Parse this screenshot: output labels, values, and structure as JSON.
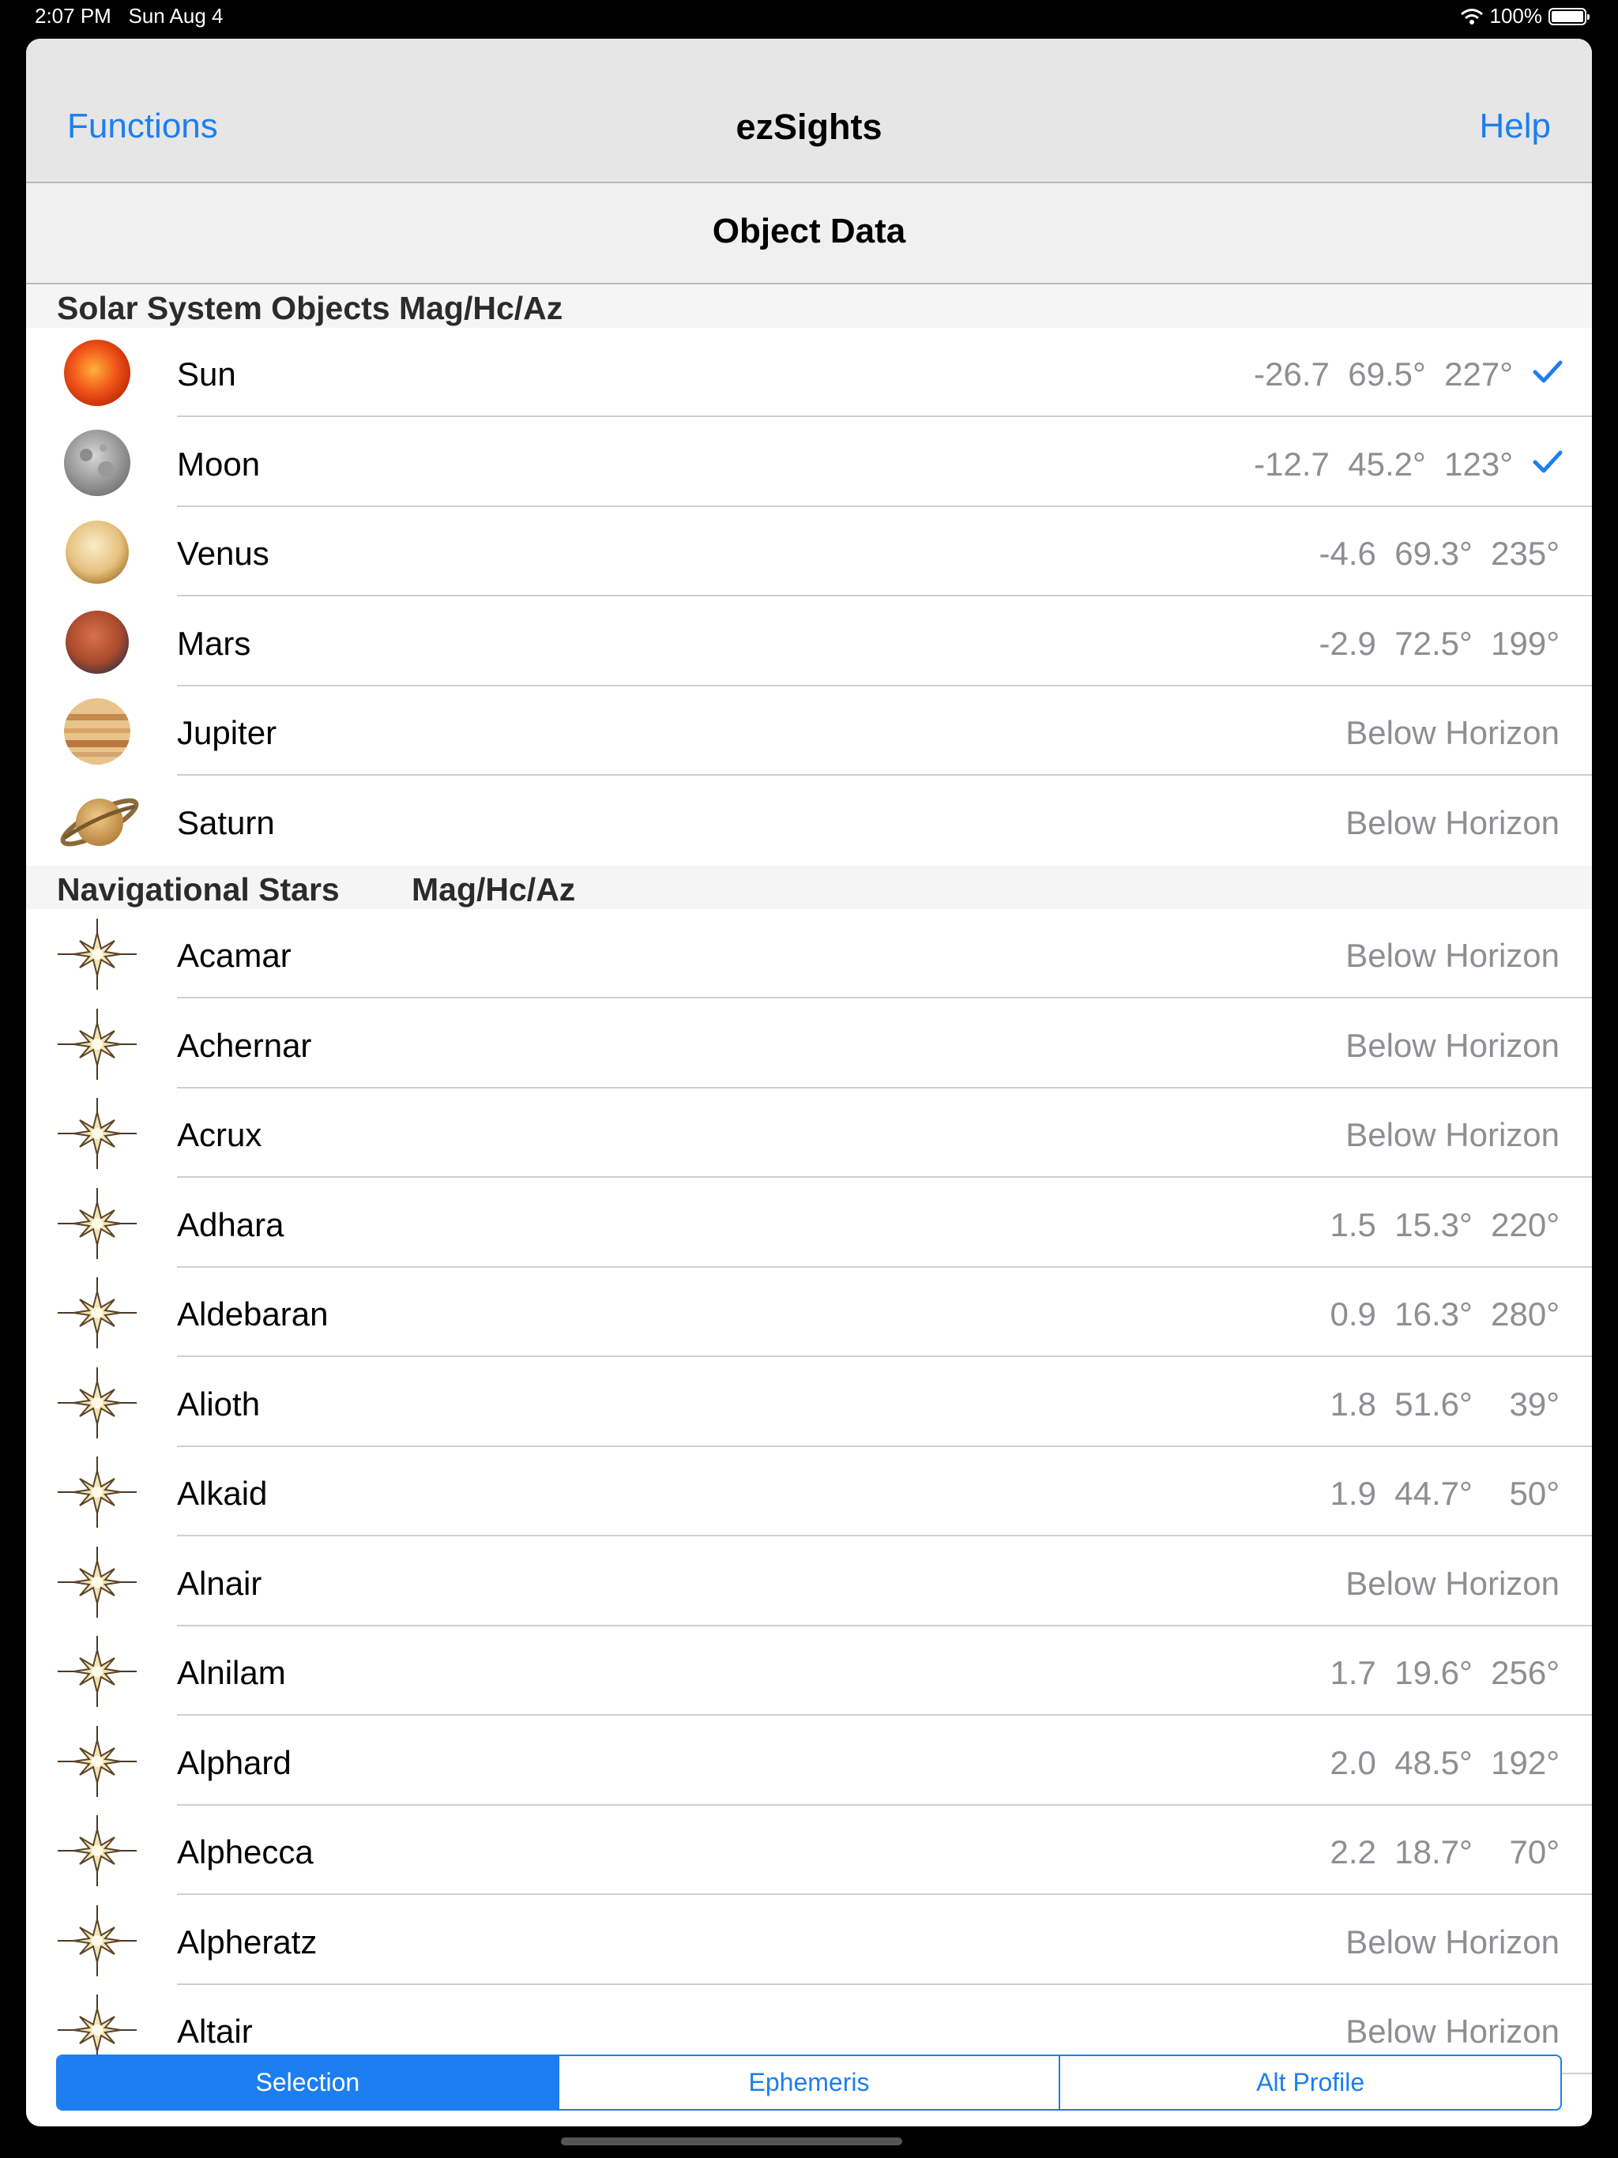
{
  "status_bar": {
    "time": "2:07 PM",
    "date": "Sun Aug 4",
    "battery": "100%",
    "wifi_icon": "wifi-icon"
  },
  "nav": {
    "left_label": "Functions",
    "title": "ezSights",
    "right_label": "Help"
  },
  "subheader": {
    "title": "Object Data"
  },
  "solar_section": {
    "title": "Solar System Objects Mag/Hc/Az"
  },
  "solar_objects": [
    {
      "name": "Sun",
      "values": "-26.7  69.5°  227°",
      "checked": true,
      "icon": "sun-icon"
    },
    {
      "name": "Moon",
      "values": "-12.7  45.2°  123°",
      "checked": true,
      "icon": "moon-icon"
    },
    {
      "name": "Venus",
      "values": "-4.6  69.3°  235°",
      "checked": false,
      "icon": "venus-icon"
    },
    {
      "name": "Mars",
      "values": "-2.9  72.5°  199°",
      "checked": false,
      "icon": "mars-icon"
    },
    {
      "name": "Jupiter",
      "values": "Below Horizon",
      "checked": false,
      "icon": "jupiter-icon"
    },
    {
      "name": "Saturn",
      "values": "Below Horizon",
      "checked": false,
      "icon": "saturn-icon"
    }
  ],
  "stars_section": {
    "title": "Navigational Stars",
    "columns": "Mag/Hc/Az"
  },
  "stars": [
    {
      "name": "Acamar",
      "values": "Below Horizon"
    },
    {
      "name": "Achernar",
      "values": "Below Horizon"
    },
    {
      "name": "Acrux",
      "values": "Below Horizon"
    },
    {
      "name": "Adhara",
      "values": "1.5  15.3°  220°"
    },
    {
      "name": "Aldebaran",
      "values": "0.9  16.3°  280°"
    },
    {
      "name": "Alioth",
      "values": "1.8  51.6°    39°"
    },
    {
      "name": "Alkaid",
      "values": "1.9  44.7°    50°"
    },
    {
      "name": "Alnair",
      "values": "Below Horizon"
    },
    {
      "name": "Alnilam",
      "values": "1.7  19.6°  256°"
    },
    {
      "name": "Alphard",
      "values": "2.0  48.5°  192°"
    },
    {
      "name": "Alphecca",
      "values": "2.2  18.7°    70°"
    },
    {
      "name": "Alpheratz",
      "values": "Below Horizon"
    },
    {
      "name": "Altair",
      "values": "Below Horizon"
    }
  ],
  "segments": [
    {
      "label": "Selection",
      "active": true
    },
    {
      "label": "Ephemeris",
      "active": false
    },
    {
      "label": "Alt Profile",
      "active": false
    }
  ],
  "colors": {
    "accent": "#1c7ef0",
    "value_text": "#8e8e93"
  }
}
